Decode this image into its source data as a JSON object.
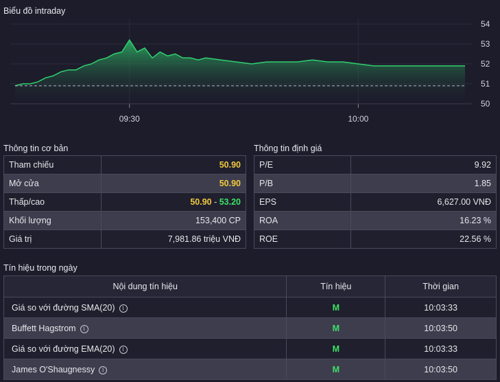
{
  "chart": {
    "title": "Biểu đồ intraday",
    "y_ticks": [
      "54",
      "53",
      "52",
      "51",
      "50"
    ],
    "x_ticks": [
      "09:30",
      "10:00"
    ],
    "reference_line": 50.9,
    "accent_color": "#2fd16f"
  },
  "chart_data": {
    "type": "area",
    "title": "Biểu đồ intraday",
    "ylim": [
      50,
      54
    ],
    "x_ticks": [
      "09:30",
      "10:00"
    ],
    "reference": 50.9,
    "x": [
      "09:15",
      "09:16",
      "09:17",
      "09:18",
      "09:19",
      "09:20",
      "09:21",
      "09:22",
      "09:23",
      "09:24",
      "09:25",
      "09:26",
      "09:27",
      "09:28",
      "09:29",
      "09:30",
      "09:31",
      "09:32",
      "09:33",
      "09:34",
      "09:35",
      "09:36",
      "09:37",
      "09:38",
      "09:39",
      "09:40",
      "09:42",
      "09:44",
      "09:46",
      "09:48",
      "09:50",
      "09:52",
      "09:54",
      "09:56",
      "09:58",
      "10:00",
      "10:02",
      "10:04",
      "10:06",
      "10:08",
      "10:10",
      "10:12",
      "10:14"
    ],
    "values": [
      50.9,
      51.0,
      51.0,
      51.1,
      51.3,
      51.4,
      51.6,
      51.7,
      51.7,
      51.9,
      52.0,
      52.2,
      52.3,
      52.5,
      52.6,
      53.2,
      52.6,
      52.8,
      52.3,
      52.6,
      52.4,
      52.5,
      52.3,
      52.3,
      52.2,
      52.3,
      52.2,
      52.1,
      52.0,
      52.1,
      52.1,
      52.1,
      52.2,
      52.1,
      52.1,
      52.0,
      51.9,
      51.9,
      51.9,
      51.9,
      51.9,
      51.9,
      51.9
    ]
  },
  "basic": {
    "title": "Thông tin cơ bản",
    "rows": [
      {
        "label": "Tham chiếu",
        "value": "50.90"
      },
      {
        "label": "Mở cửa",
        "value": "50.90"
      },
      {
        "label": "Thấp/cao",
        "low": "50.90",
        "sep": " - ",
        "high": "53.20"
      },
      {
        "label": "Khối lượng",
        "value": "153,400 CP"
      },
      {
        "label": "Giá trị",
        "value": "7,981.86 triệu VNĐ"
      }
    ]
  },
  "valuation": {
    "title": "Thông tin định giá",
    "rows": [
      {
        "label": "P/E",
        "value": "9.92"
      },
      {
        "label": "P/B",
        "value": "1.85"
      },
      {
        "label": "EPS",
        "value": "6,627.00 VNĐ"
      },
      {
        "label": "ROA",
        "value": "16.23 %"
      },
      {
        "label": "ROE",
        "value": "22.56 %"
      }
    ]
  },
  "signals": {
    "title": "Tín hiệu trong ngày",
    "headers": [
      "Nội dung tín hiệu",
      "Tín hiệu",
      "Thời gian"
    ],
    "info_glyph": "i",
    "rows": [
      {
        "name": "Giá so với đường SMA(20)",
        "signal": "M",
        "time": "10:03:33"
      },
      {
        "name": "Buffett Hagstrom",
        "signal": "M",
        "time": "10:03:50"
      },
      {
        "name": "Giá so với đường EMA(20)",
        "signal": "M",
        "time": "10:03:33"
      },
      {
        "name": "James O'Shaugnessy",
        "signal": "M",
        "time": "10:03:50"
      }
    ]
  }
}
